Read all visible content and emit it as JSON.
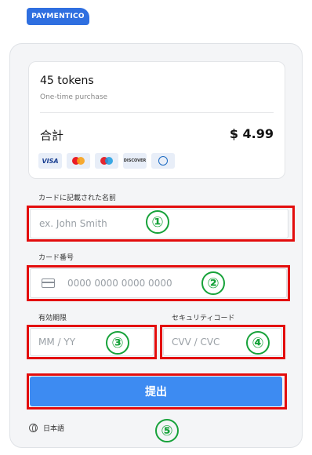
{
  "brand": {
    "logo_text": "PAYMENTICO",
    "color": "#2f6fe0"
  },
  "summary": {
    "product": "45 tokens",
    "purchase_type": "One-time purchase",
    "total_label": "合計",
    "total_value": "$ 4.99",
    "card_logos": [
      "VISA",
      "mastercard",
      "maestro",
      "DISCOVER",
      "diners"
    ]
  },
  "form": {
    "name": {
      "label": "カードに記載された名前",
      "placeholder": "ex. John Smith"
    },
    "card_number": {
      "label": "カード番号",
      "placeholder": "0000 0000 0000 0000"
    },
    "expiry": {
      "label": "有効期限",
      "placeholder": "MM / YY"
    },
    "cvc": {
      "label": "セキュリティコード",
      "placeholder": "CVV / CVC"
    },
    "submit_label": "提出"
  },
  "language": {
    "label": "日本語"
  },
  "annotations": {
    "markers": [
      "①",
      "②",
      "③",
      "④",
      "⑤"
    ],
    "outline_color": "#e30d0d",
    "marker_color": "#17a23a"
  }
}
